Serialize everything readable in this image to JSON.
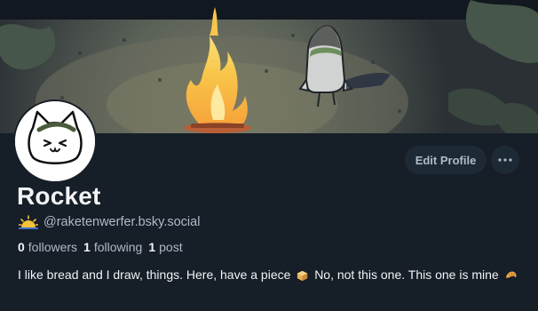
{
  "profile": {
    "display_name": "Rocket",
    "handle": "@raketenwerfer.bsky.social",
    "followers_count": "0",
    "followers_label": "followers",
    "following_count": "1",
    "following_label": "following",
    "posts_count": "1",
    "posts_label": "post",
    "bio_part1": "I like bread and I draw, things. Here, have a piece",
    "bio_part2": "No, not this one. This one is mine",
    "bio_emoji_1": "bread-icon",
    "bio_emoji_2": "croissant-icon",
    "handle_badge_icon": "sunrise-icon"
  },
  "actions": {
    "edit_profile_label": "Edit Profile",
    "more_icon": "ellipsis-icon"
  },
  "banner": {
    "icon": "campfire-and-rocket-illustration"
  },
  "colors": {
    "background": "#161e27",
    "button_bg": "#1e2936",
    "muted_text": "#aebbc9",
    "primary_text": "#f1f3f5"
  }
}
